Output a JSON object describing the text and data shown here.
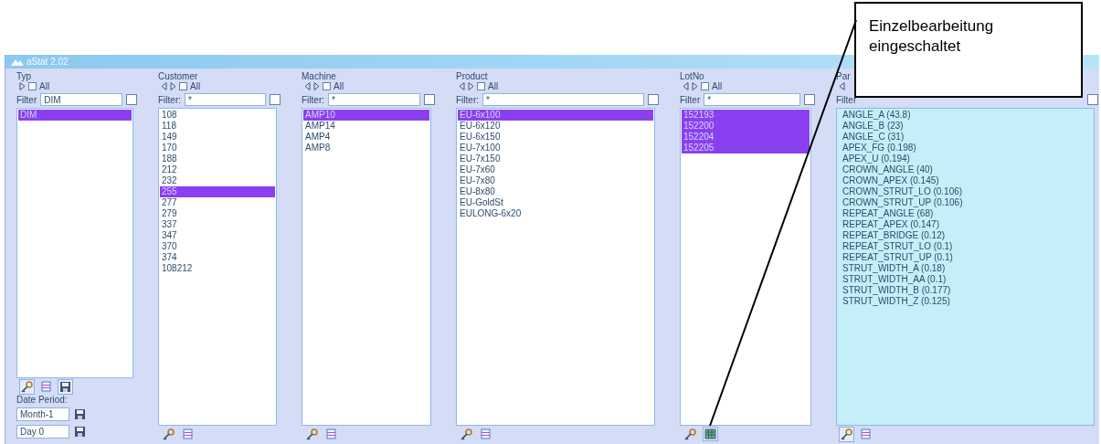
{
  "window": {
    "title": "aStat 2.02"
  },
  "columns": [
    {
      "kind": "list",
      "label": "Typ",
      "prev_arrow": false,
      "next_arrow": true,
      "all": {
        "label": "All",
        "checked": false
      },
      "filter": {
        "label": "Filter",
        "value": "DIM",
        "checked": false
      },
      "items": [
        {
          "text": "DIM",
          "selected": true
        }
      ],
      "tools": [
        {
          "kind": "key",
          "active": true
        },
        {
          "kind": "list",
          "active": false
        },
        {
          "kind": "save",
          "active": true
        }
      ]
    },
    {
      "kind": "list",
      "label": "Customer",
      "prev_arrow": true,
      "next_arrow": true,
      "all": {
        "label": "All",
        "checked": false
      },
      "filter": {
        "label": "Filter:",
        "value": "*",
        "checked": false
      },
      "items": [
        {
          "text": "108",
          "selected": false
        },
        {
          "text": "118",
          "selected": false
        },
        {
          "text": "149",
          "selected": false
        },
        {
          "text": "170",
          "selected": false
        },
        {
          "text": "188",
          "selected": false
        },
        {
          "text": "212",
          "selected": false
        },
        {
          "text": "232",
          "selected": false
        },
        {
          "text": "255",
          "selected": true
        },
        {
          "text": "277",
          "selected": false
        },
        {
          "text": "279",
          "selected": false
        },
        {
          "text": "337",
          "selected": false
        },
        {
          "text": "347",
          "selected": false
        },
        {
          "text": "370",
          "selected": false
        },
        {
          "text": "374",
          "selected": false
        },
        {
          "text": "108212",
          "selected": false
        }
      ],
      "tools": [
        {
          "kind": "key",
          "active": false
        },
        {
          "kind": "list",
          "active": false
        }
      ]
    },
    {
      "kind": "list",
      "label": "Machine",
      "prev_arrow": true,
      "next_arrow": true,
      "all": {
        "label": "All",
        "checked": false
      },
      "filter": {
        "label": "Filter:",
        "value": "*",
        "checked": false
      },
      "items": [
        {
          "text": "AMP10",
          "selected": true
        },
        {
          "text": "AMP14",
          "selected": false
        },
        {
          "text": "AMP4",
          "selected": false
        },
        {
          "text": "AMP8",
          "selected": false
        }
      ],
      "tools": [
        {
          "kind": "key",
          "active": false
        },
        {
          "kind": "list",
          "active": false
        }
      ]
    },
    {
      "kind": "list",
      "label": "Product",
      "prev_arrow": true,
      "next_arrow": true,
      "all": {
        "label": "All",
        "checked": false
      },
      "filter": {
        "label": "Filter:",
        "value": "*",
        "checked": false
      },
      "items": [
        {
          "text": "EU-6x100",
          "selected": true
        },
        {
          "text": "EU-6x120",
          "selected": false
        },
        {
          "text": "EU-6x150",
          "selected": false
        },
        {
          "text": "EU-7x100",
          "selected": false
        },
        {
          "text": "EU-7x150",
          "selected": false
        },
        {
          "text": "EU-7x60",
          "selected": false
        },
        {
          "text": "EU-7x80",
          "selected": false
        },
        {
          "text": "EU-8x80",
          "selected": false
        },
        {
          "text": "EU-GoldSt",
          "selected": false
        },
        {
          "text": "EULONG-6x20",
          "selected": false
        }
      ],
      "tools": [
        {
          "kind": "key",
          "active": false
        },
        {
          "kind": "list",
          "active": false
        }
      ]
    },
    {
      "kind": "list",
      "label": "LotNo",
      "prev_arrow": true,
      "next_arrow": true,
      "all": {
        "label": "All",
        "checked": false
      },
      "filter": {
        "label": "Filter",
        "value": "*",
        "checked": false
      },
      "items": [
        {
          "text": "152193",
          "selected": true
        },
        {
          "text": "152200",
          "selected": true
        },
        {
          "text": "152204",
          "selected": true
        },
        {
          "text": "152205",
          "selected": true
        }
      ],
      "tools": [
        {
          "kind": "key",
          "active": false
        },
        {
          "kind": "grid",
          "active": true
        }
      ]
    },
    {
      "kind": "params",
      "label": "Par",
      "prev_arrow": true,
      "next_arrow": false,
      "filter": {
        "label": "Filter",
        "checked": false
      },
      "items": [
        {
          "text": "ANGLE_A (43.8)",
          "selected": false
        },
        {
          "text": "ANGLE_B (23)",
          "selected": false
        },
        {
          "text": "ANGLE_C (31)",
          "selected": false
        },
        {
          "text": "APEX_FG (0.198)",
          "selected": false
        },
        {
          "text": "APEX_U (0.194)",
          "selected": false
        },
        {
          "text": "CROWN_ANGLE (40)",
          "selected": false
        },
        {
          "text": "CROWN_APEX (0.145)",
          "selected": false
        },
        {
          "text": "CROWN_STRUT_LO (0.106)",
          "selected": false
        },
        {
          "text": "CROWN_STRUT_UP (0.106)",
          "selected": false
        },
        {
          "text": "REPEAT_ANGLE (68)",
          "selected": false
        },
        {
          "text": "REPEAT_APEX (0.147)",
          "selected": false
        },
        {
          "text": "REPEAT_BRIDGE (0.12)",
          "selected": false
        },
        {
          "text": "REPEAT_STRUT_LO (0.1)",
          "selected": false
        },
        {
          "text": "REPEAT_STRUT_UP (0.1)",
          "selected": false
        },
        {
          "text": "STRUT_WIDTH_A (0.18)",
          "selected": false
        },
        {
          "text": "STRUT_WIDTH_AA (0.1)",
          "selected": false
        },
        {
          "text": "STRUT_WIDTH_B (0.177)",
          "selected": false
        },
        {
          "text": "STRUT_WIDTH_Z (0.125)",
          "selected": false
        }
      ],
      "tools": [
        {
          "kind": "key",
          "active": true
        },
        {
          "kind": "list",
          "active": false
        }
      ]
    }
  ],
  "date_period": {
    "label": "Date Period:",
    "fields": [
      {
        "value": "Month-1"
      },
      {
        "value": "Day 0"
      }
    ]
  },
  "callout": {
    "text": "Einzelbearbeitung eingeschaltet"
  }
}
